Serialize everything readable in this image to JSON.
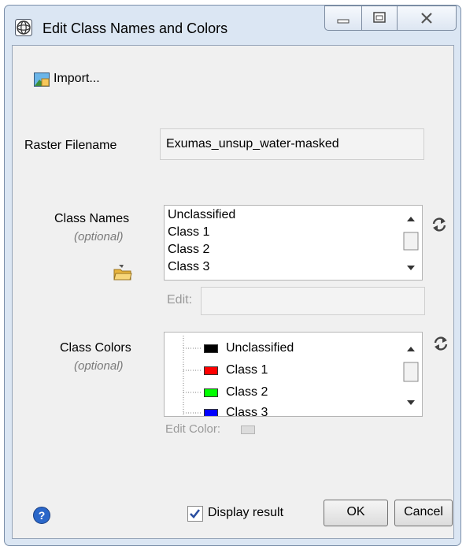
{
  "window": {
    "title": "Edit Class Names and Colors"
  },
  "toolbar": {
    "import_label": "Import..."
  },
  "raster": {
    "label": "Raster Filename",
    "value": "Exumas_unsup_water-masked"
  },
  "class_names": {
    "label": "Class Names",
    "optional": "(optional)",
    "items": [
      "Unclassified",
      "Class 1",
      "Class 2",
      "Class 3"
    ],
    "edit_label": "Edit:",
    "edit_value": ""
  },
  "class_colors": {
    "label": "Class Colors",
    "optional": "(optional)",
    "items": [
      {
        "name": "Unclassified",
        "color": "#000000"
      },
      {
        "name": "Class 1",
        "color": "#ff0000"
      },
      {
        "name": "Class 2",
        "color": "#00ff00"
      },
      {
        "name": "Class 3",
        "color": "#0000ff"
      }
    ],
    "edit_color_label": "Edit Color:"
  },
  "footer": {
    "display_result_label": "Display result",
    "display_result_checked": true,
    "ok_label": "OK",
    "cancel_label": "Cancel"
  },
  "icons": {
    "app": "envi-globe-icon",
    "import": "import-image-icon",
    "folder": "open-folder-icon",
    "refresh": "refresh-icon",
    "help": "help-icon"
  }
}
